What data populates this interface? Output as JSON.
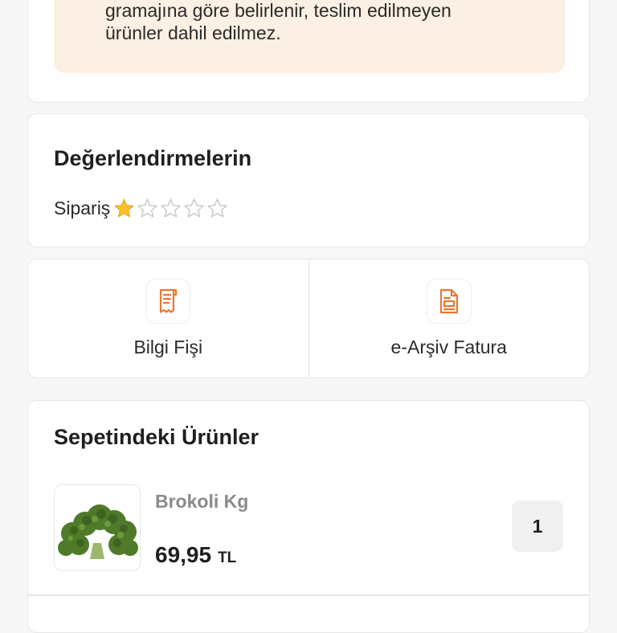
{
  "notice": {
    "lines": [
      "gramajına göre belirlenir, teslim edilmeyen",
      "ürünler dahil edilmez."
    ],
    "background_color": "#fcefe3"
  },
  "reviews": {
    "title": "Değerlendirmelerin",
    "order_label": "Sipariş",
    "rating": 1,
    "max_rating": 5,
    "star_filled_color": "#f7c02a",
    "star_empty_color": "#c8c8c8",
    "star_icon": "star-icon"
  },
  "documents": [
    {
      "label": "Bilgi Fişi",
      "icon": "receipt-icon",
      "icon_color": "#e8782e"
    },
    {
      "label": "e-Arşiv Fatura",
      "icon": "invoice-icon",
      "icon_color": "#e8782e"
    }
  ],
  "basket": {
    "title": "Sepetindeki Ürünler",
    "items": [
      {
        "name": "Brokoli Kg",
        "price": "69,95",
        "currency": "TL",
        "quantity": "1",
        "image": "broccoli-image"
      }
    ]
  }
}
